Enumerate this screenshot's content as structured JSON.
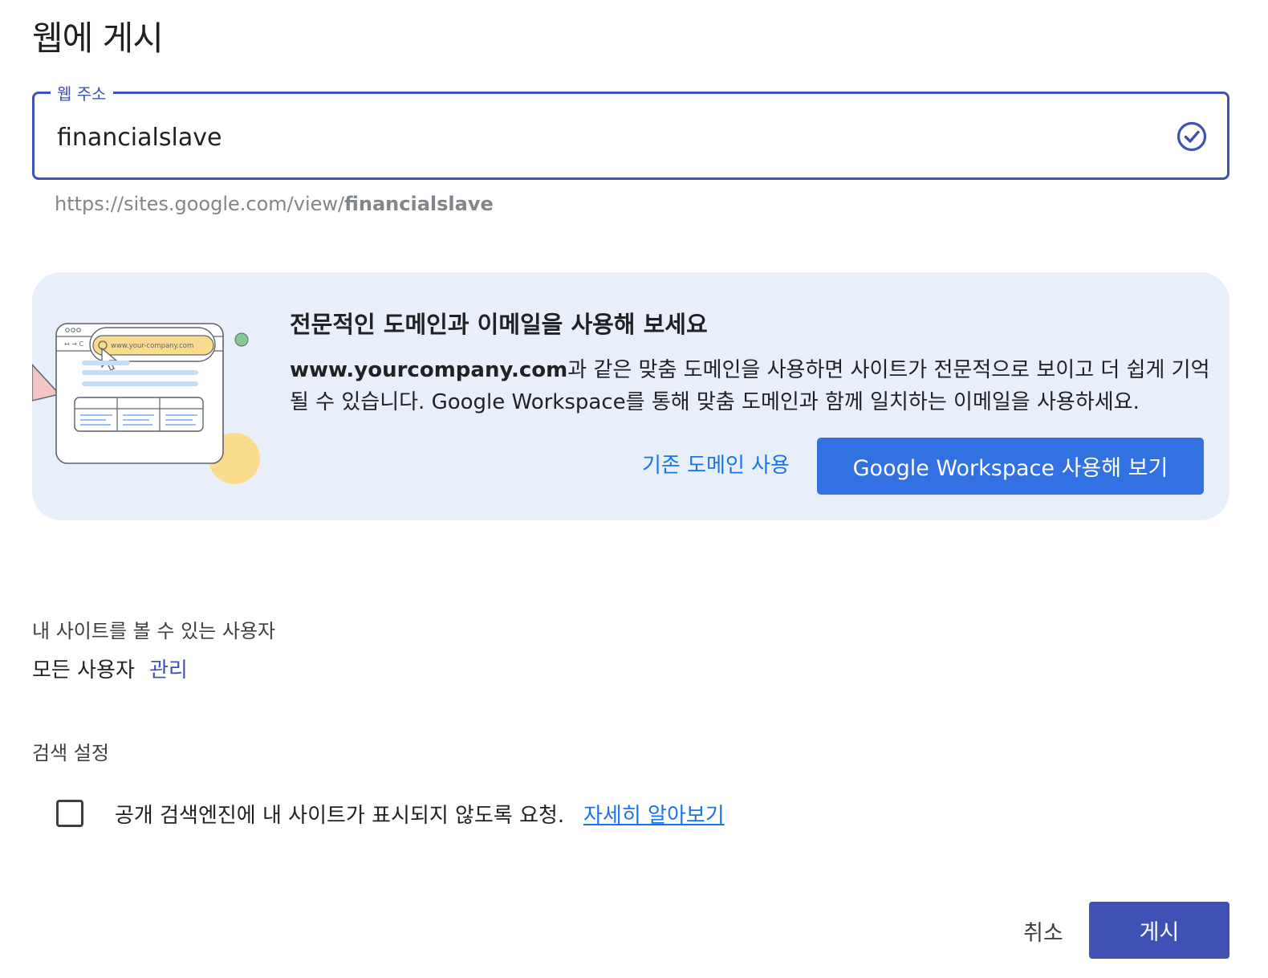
{
  "dialog": {
    "title": "웹에 게시"
  },
  "address_field": {
    "label": "웹 주소",
    "value": "financialslave",
    "status_icon": "check-circle-icon",
    "url_prefix": "https://sites.google.com/view/",
    "url_slug": "financialslave"
  },
  "promo": {
    "illustration_url": "www.your-company.com",
    "title": "전문적인 도메인과 이메일을 사용해 보세요",
    "body_bold": "www.yourcompany.com",
    "body_rest": "과 같은 맞춤 도메인을 사용하면 사이트가 전문적으로 보이고 더 쉽게 기억될 수 있습니다. Google Workspace를 통해 맞춤 도메인과 함께 일치하는 이메일을 사용하세요.",
    "secondary_action": "기존 도메인 사용",
    "primary_action": "Google Workspace 사용해 보기"
  },
  "visibility": {
    "heading": "내 사이트를 볼 수 있는 사용자",
    "value": "모든 사용자",
    "manage_link": "관리"
  },
  "search_settings": {
    "heading": "검색 설정",
    "checkbox_checked": false,
    "checkbox_label": "공개 검색엔진에 내 사이트가 표시되지 않도록 요청.",
    "learn_more": "자세히 알아보기"
  },
  "footer": {
    "cancel_label": "취소",
    "publish_label": "게시"
  },
  "colors": {
    "accent": "#3f51b5",
    "link_blue": "#1a73e8",
    "workspace_button": "#3271e2",
    "promo_background": "#e8effa"
  }
}
